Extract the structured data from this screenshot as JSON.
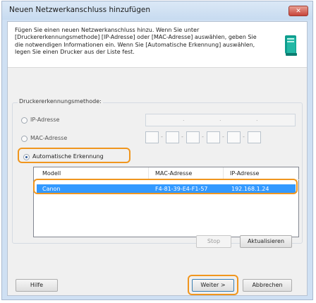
{
  "window": {
    "title": "Neuen Netzwerkanschluss hinzufügen",
    "close_label": "✕"
  },
  "header": {
    "description": "Fügen Sie einen neuen Netzwerkanschluss hinzu. Wenn Sie unter [Druckererkennungsmethode] [IP-Adresse] oder [MAC-Adresse] auswählen, geben Sie die notwendigen Informationen ein. Wenn Sie [Automatische Erkennung] auswählen, legen Sie einen Drucker aus der Liste fest.",
    "icon": "computer-icon"
  },
  "detection": {
    "group_label": "Druckererkennungsmethode:",
    "options": [
      {
        "label": "IP-Adresse",
        "checked": false
      },
      {
        "label": "MAC-Adresse",
        "checked": false
      },
      {
        "label": "Automatische Erkennung",
        "checked": true
      }
    ],
    "ip_separators": [
      ".",
      ".",
      "."
    ],
    "mac_separators": [
      "-",
      "-",
      "-",
      "-",
      "-"
    ]
  },
  "printer_list": {
    "columns": [
      "Modell",
      "MAC-Adresse",
      "IP-Adresse"
    ],
    "rows": [
      {
        "model": "Canon",
        "mac": "F4-81-39-E4-F1-57",
        "ip": "192.168.1.24",
        "selected": true
      }
    ]
  },
  "buttons": {
    "stop": "Stop",
    "refresh": "Aktualisieren",
    "help": "Hilfe",
    "next": "Weiter >",
    "cancel": "Abbrechen"
  },
  "colors": {
    "highlight": "#f0961e",
    "selection": "#3399ff"
  }
}
